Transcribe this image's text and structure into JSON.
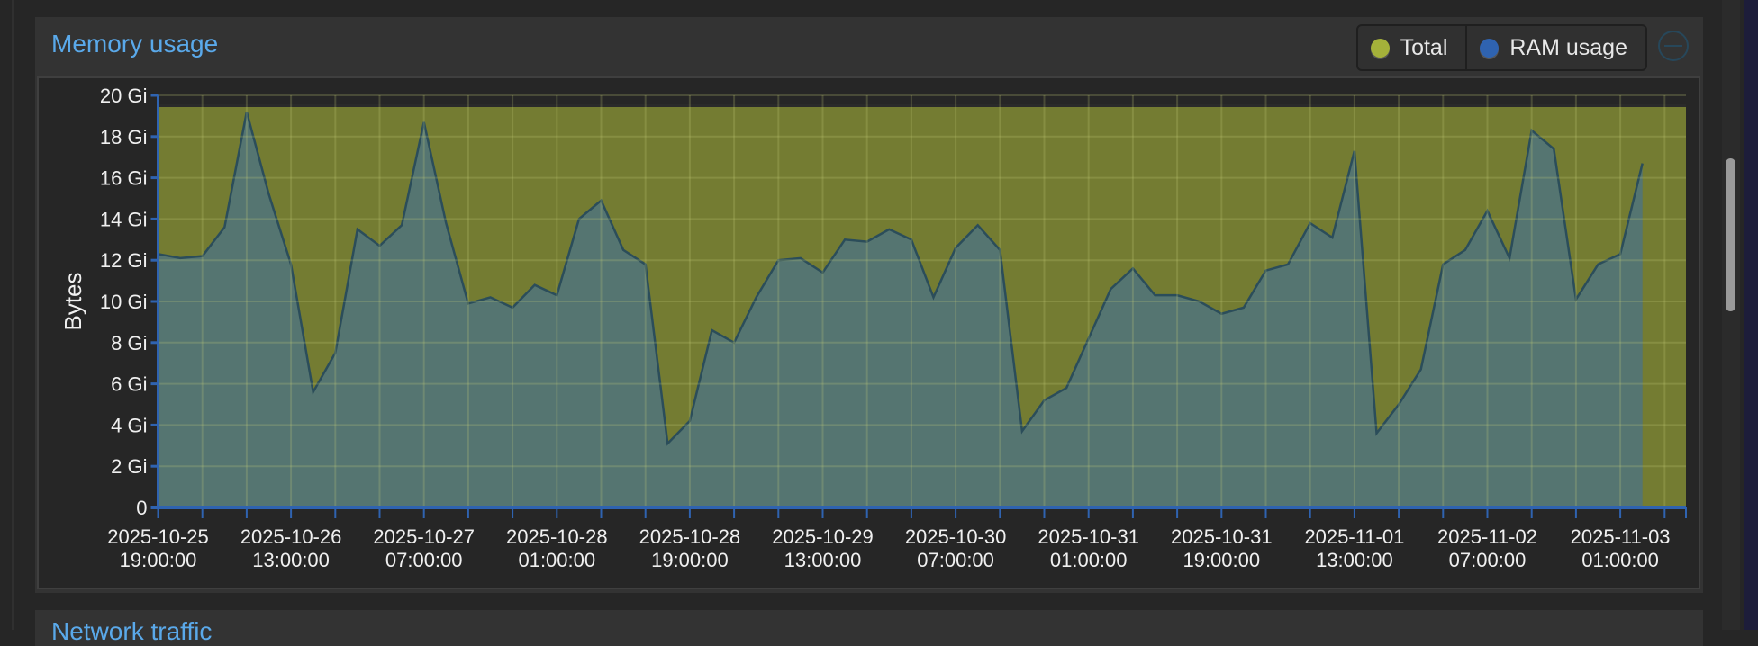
{
  "panel": {
    "title": "Memory usage",
    "legend": [
      {
        "label": "Total",
        "color": "#a4b13a"
      },
      {
        "label": "RAM usage",
        "color": "#2f63b0"
      }
    ],
    "collapse_icon": "minus-circle-icon"
  },
  "next_panel": {
    "title": "Network traffic"
  },
  "chart_data": {
    "type": "area",
    "title": "Memory usage",
    "ylabel": "Bytes",
    "xlabel": "",
    "ylim": [
      0,
      20
    ],
    "y_unit": "Gi",
    "y_ticks": [
      "0",
      "2 Gi",
      "4 Gi",
      "6 Gi",
      "8 Gi",
      "10 Gi",
      "12 Gi",
      "14 Gi",
      "16 Gi",
      "18 Gi",
      "20 Gi"
    ],
    "x_start": "2025-10-25 19:00:00",
    "x_step_hours": 3,
    "x_tick_labels": [
      [
        "2025-10-25",
        "19:00:00"
      ],
      [
        "2025-10-26",
        "13:00:00"
      ],
      [
        "2025-10-27",
        "07:00:00"
      ],
      [
        "2025-10-28",
        "01:00:00"
      ],
      [
        "2025-10-28",
        "19:00:00"
      ],
      [
        "2025-10-29",
        "13:00:00"
      ],
      [
        "2025-10-30",
        "07:00:00"
      ],
      [
        "2025-10-31",
        "01:00:00"
      ],
      [
        "2025-10-31",
        "19:00:00"
      ],
      [
        "2025-11-01",
        "13:00:00"
      ],
      [
        "2025-11-02",
        "07:00:00"
      ],
      [
        "2025-11-03",
        "01:00:00"
      ]
    ],
    "grid": true,
    "legend_position": "top-right",
    "series": [
      {
        "name": "Total",
        "color": "#a4b13a",
        "constant": 19.5,
        "points": 70
      },
      {
        "name": "RAM usage",
        "color": "#2f63b0",
        "values": [
          12.3,
          12.1,
          12.2,
          13.6,
          19.2,
          15.2,
          11.8,
          5.6,
          7.5,
          13.5,
          12.7,
          13.7,
          18.7,
          13.8,
          9.9,
          10.2,
          9.7,
          10.8,
          10.3,
          14.0,
          14.9,
          12.5,
          11.8,
          3.1,
          4.2,
          8.6,
          8.0,
          10.2,
          12.0,
          12.1,
          11.4,
          13.0,
          12.9,
          13.5,
          13.0,
          10.2,
          12.6,
          13.7,
          12.5,
          3.7,
          5.2,
          5.8,
          8.2,
          10.6,
          11.6,
          10.3,
          10.3,
          10.0,
          9.4,
          9.7,
          11.5,
          11.8,
          13.8,
          13.1,
          17.3,
          3.6,
          5.0,
          6.7,
          11.8,
          12.5,
          14.4,
          12.1,
          18.3,
          17.4,
          10.1,
          11.8,
          12.3,
          16.7
        ]
      }
    ]
  }
}
